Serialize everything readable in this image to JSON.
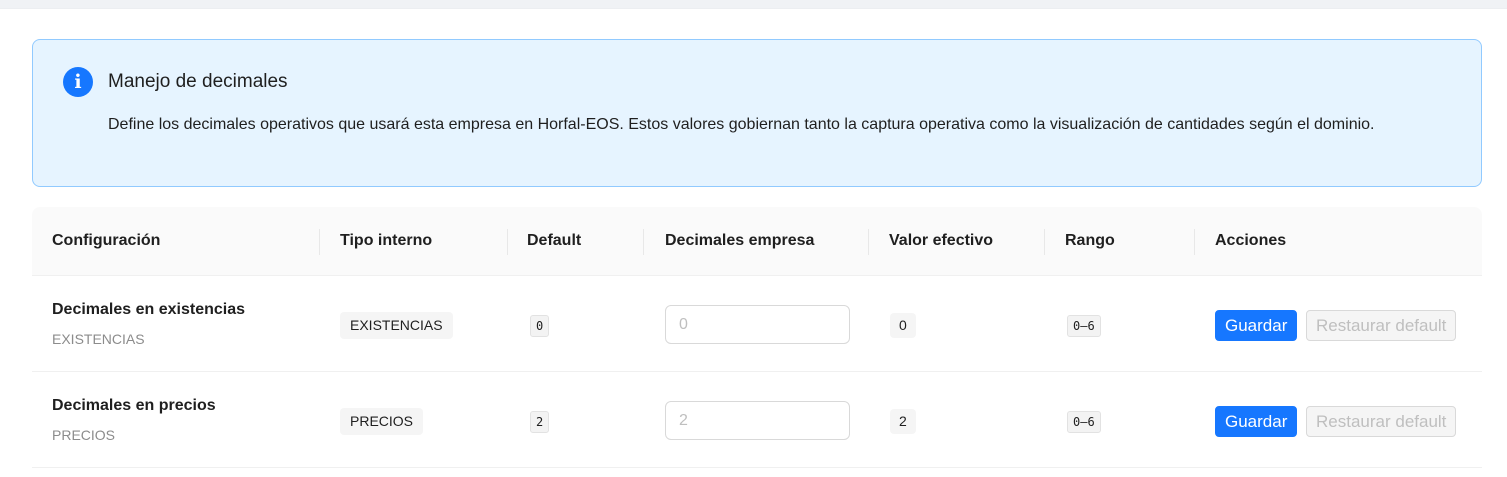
{
  "alert": {
    "icon": "info-icon",
    "title": "Manejo de decimales",
    "description": "Define los decimales operativos que usará esta empresa en Horfal-EOS. Estos valores gobiernan tanto la captura operativa como la visualización de cantidades según el dominio."
  },
  "table": {
    "columns": [
      "Configuración",
      "Tipo interno",
      "Default",
      "Decimales empresa",
      "Valor efectivo",
      "Rango",
      "Acciones"
    ],
    "rows": [
      {
        "label": "Decimales en existencias",
        "key": "EXISTENCIAS",
        "tipo": "EXISTENCIAS",
        "default": "0",
        "input_value": "",
        "input_placeholder": "0",
        "effective": "0",
        "range": "0–6",
        "save_label": "Guardar",
        "restore_label": "Restaurar default"
      },
      {
        "label": "Decimales en precios",
        "key": "PRECIOS",
        "tipo": "PRECIOS",
        "default": "2",
        "input_value": "",
        "input_placeholder": "2",
        "effective": "2",
        "range": "0–6",
        "save_label": "Guardar",
        "restore_label": "Restaurar default"
      }
    ]
  },
  "colors": {
    "primary": "#1677ff",
    "alert_bg": "#e6f4ff",
    "alert_border": "#91caff"
  }
}
